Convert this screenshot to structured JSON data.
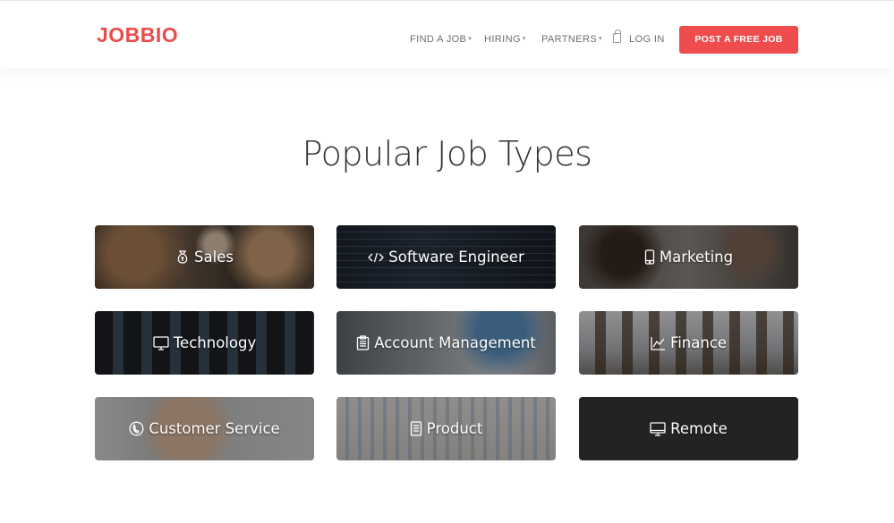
{
  "header": {
    "logo": "JOBBIO",
    "nav": [
      {
        "label": "FIND A JOB",
        "has_caret": true
      },
      {
        "label": "HIRING",
        "has_caret": true
      },
      {
        "label": "PARTNERS",
        "has_caret": true
      },
      {
        "label": "LOG IN",
        "icon": "lock-icon"
      }
    ],
    "cta_label": "POST A FREE JOB",
    "caret": "▾"
  },
  "main": {
    "title": "Popular Job Types",
    "cards": [
      {
        "label": "Sales",
        "icon": "money-bag-icon"
      },
      {
        "label": "Software Engineer",
        "icon": "code-icon"
      },
      {
        "label": "Marketing",
        "icon": "mobile-phone-icon"
      },
      {
        "label": "Technology",
        "icon": "monitor-icon"
      },
      {
        "label": "Account Management",
        "icon": "clipboard-icon"
      },
      {
        "label": "Finance",
        "icon": "line-chart-icon"
      },
      {
        "label": "Customer Service",
        "icon": "phone-call-icon"
      },
      {
        "label": "Product",
        "icon": "document-icon"
      },
      {
        "label": "Remote",
        "icon": "desktop-icon"
      }
    ]
  },
  "colors": {
    "brand": "#e94c4c",
    "cta": "#ef4d4d",
    "nav_text": "#6d6d6d",
    "title_text": "#333333"
  }
}
